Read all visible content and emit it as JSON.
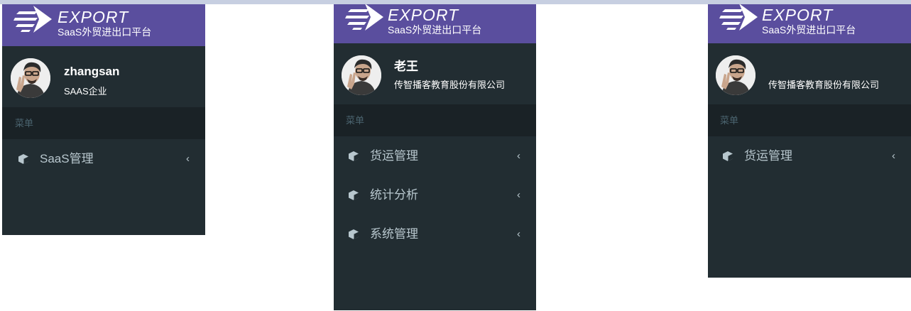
{
  "brand": {
    "word": "EXPORT",
    "subtitle": "SaaS外贸进出口平台",
    "color": "#5a4e9e"
  },
  "menu_header": "菜单",
  "panels": [
    {
      "user": {
        "name": "zhangsan",
        "company": "SAAS企业"
      },
      "menu": [
        {
          "icon": "cube-icon",
          "label": "SaaS管理"
        }
      ]
    },
    {
      "user": {
        "name": "老王",
        "company": "传智播客教育股份有限公司"
      },
      "menu": [
        {
          "icon": "cube-icon",
          "label": "货运管理"
        },
        {
          "icon": "cube-icon",
          "label": "统计分析"
        },
        {
          "icon": "cube-icon",
          "label": "系统管理"
        }
      ]
    },
    {
      "user": {
        "name": "",
        "company": "传智播客教育股份有限公司"
      },
      "menu": [
        {
          "icon": "cube-icon",
          "label": "货运管理"
        }
      ]
    }
  ],
  "colors": {
    "sidebar_bg": "#222d32",
    "menu_header_bg": "#1a2226",
    "menu_text": "#b8c7ce"
  }
}
